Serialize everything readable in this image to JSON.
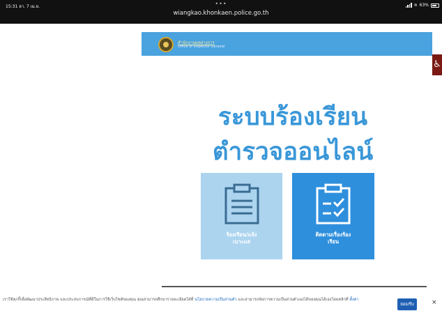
{
  "status_bar": {
    "time": "15:31  อา. 7 เม.ย.",
    "dots": "•••",
    "url": "wiangkao.khonkaen.police.go.th",
    "battery": "63%"
  },
  "header": {
    "org_th": "สำนักงานผลต่างการ",
    "org_en": "Office of Inspector General"
  },
  "accessibility": {
    "icon": "wheelchair-icon",
    "glyph": "♿"
  },
  "title": {
    "line1": "ระบบร้องเรียน",
    "line2": "ตำรวจออนไลน์"
  },
  "cards": [
    {
      "label_line1": "ร้องเรียน/แจ้ง",
      "label_line2": "เบาะแส",
      "icon": "clipboard-icon",
      "color": "#acd4ef"
    },
    {
      "label_line1": "ติดตามเรื่องร้อง",
      "label_line2": "เรียน",
      "icon": "clipboard-check-icon",
      "color": "#2e8fdd"
    }
  ],
  "cookie": {
    "text_before": "เราใช้คุกกี้เพื่อพัฒนาประสิทธิภาพ และประสบการณ์ที่ดีในการใช้เว็บไซต์ของคุณ คุณสามารถศึกษารายละเอียดได้ที่ ",
    "policy_link": "นโยบายความเป็นส่วนตัว",
    "text_after": " และสามารถจัดการความเป็นส่วนตัวเองได้ของคุณได้เองโดยคลิกที่ ",
    "settings_link": "ตั้งค่า",
    "accept_label": "ยอมรับ",
    "close_label": "×"
  },
  "colors": {
    "accent": "#3a97d8",
    "banner": "#4aa2de",
    "accept": "#1e5fb3"
  }
}
